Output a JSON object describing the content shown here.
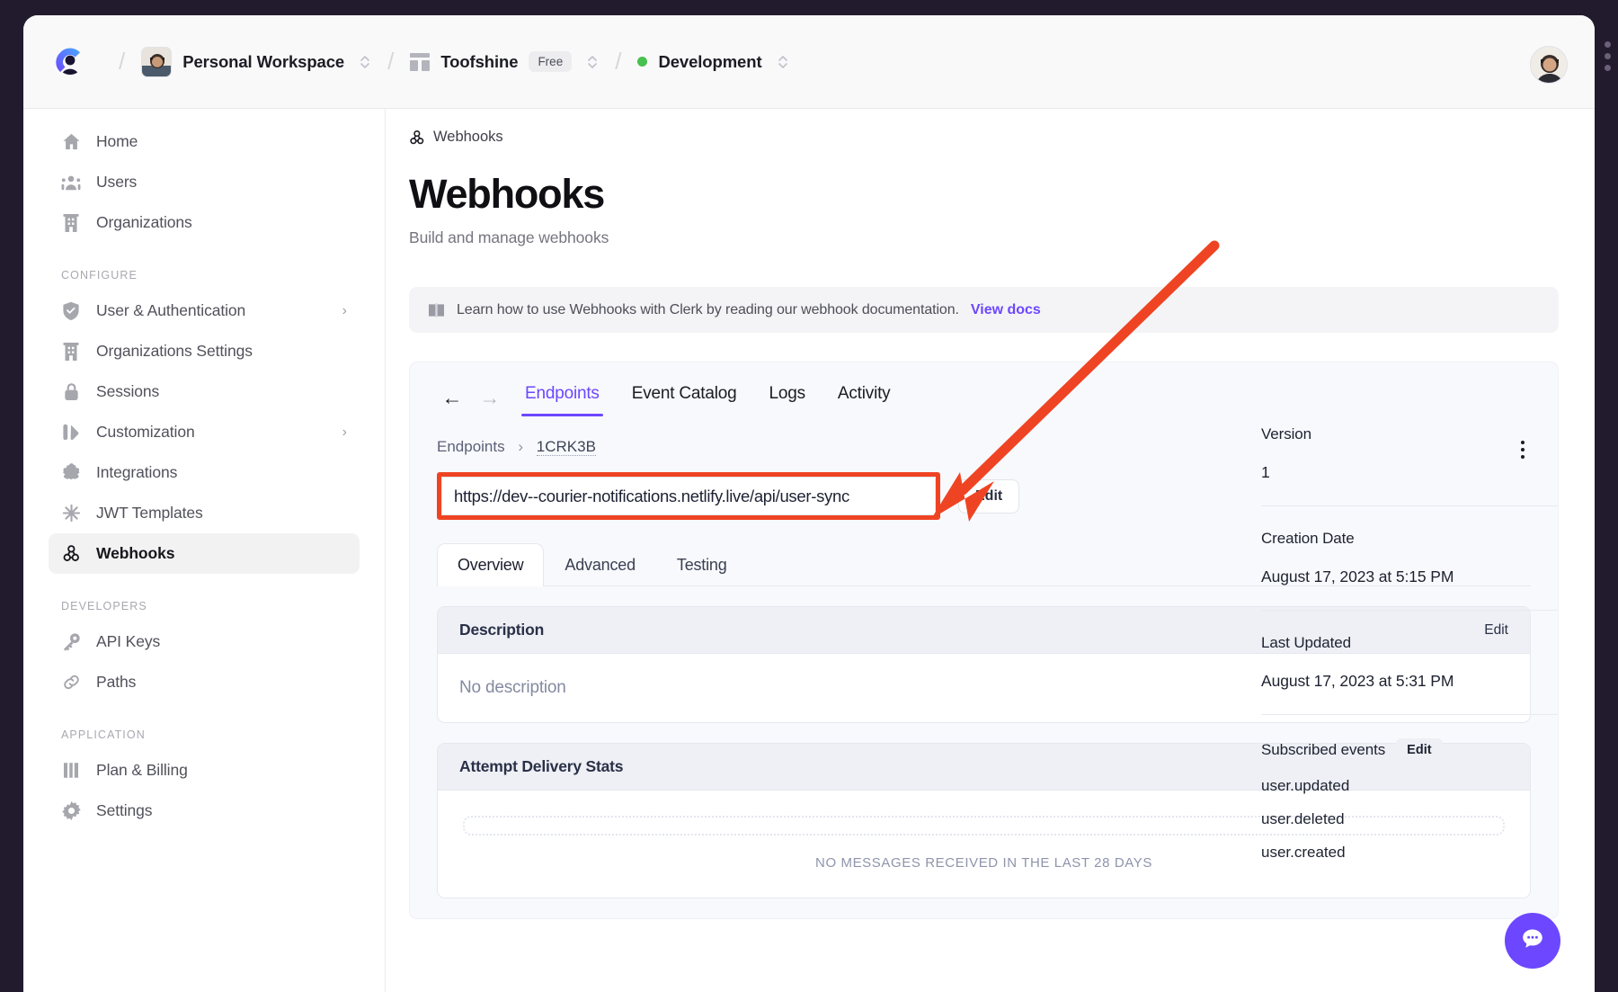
{
  "topbar": {
    "logo_icon": "clerk-logo-icon",
    "workspace": {
      "label": "Personal Workspace",
      "avatar_icon": "user-avatar-icon",
      "switcher_icon": "chevron-updown-icon"
    },
    "application": {
      "label": "Toofshine",
      "plan_badge": "Free",
      "app_icon": "app-grid-icon",
      "switcher_icon": "chevron-updown-icon"
    },
    "environment": {
      "label": "Development",
      "status_dot_color": "#46c14f",
      "switcher_icon": "chevron-updown-icon"
    },
    "separator": "/",
    "user_avatar_icon": "user-avatar-icon"
  },
  "sidebar": {
    "items": [
      {
        "label": "Home",
        "icon": "home-icon",
        "active": false,
        "chevron": false
      },
      {
        "label": "Users",
        "icon": "users-icon",
        "active": false,
        "chevron": false
      },
      {
        "label": "Organizations",
        "icon": "building-icon",
        "active": false,
        "chevron": false
      }
    ],
    "sections": [
      {
        "title": "CONFIGURE",
        "items": [
          {
            "label": "User & Authentication",
            "icon": "shield-check-icon",
            "active": false,
            "chevron": true
          },
          {
            "label": "Organizations Settings",
            "icon": "building-icon",
            "active": false,
            "chevron": false
          },
          {
            "label": "Sessions",
            "icon": "lock-icon",
            "active": false,
            "chevron": false
          },
          {
            "label": "Customization",
            "icon": "customization-icon",
            "active": false,
            "chevron": true
          },
          {
            "label": "Integrations",
            "icon": "puzzle-icon",
            "active": false,
            "chevron": false
          },
          {
            "label": "JWT Templates",
            "icon": "asterisk-icon",
            "active": false,
            "chevron": false
          },
          {
            "label": "Webhooks",
            "icon": "webhook-icon",
            "active": true,
            "chevron": false
          }
        ]
      },
      {
        "title": "DEVELOPERS",
        "items": [
          {
            "label": "API Keys",
            "icon": "key-icon",
            "active": false,
            "chevron": false
          },
          {
            "label": "Paths",
            "icon": "link-icon",
            "active": false,
            "chevron": false
          }
        ]
      },
      {
        "title": "APPLICATION",
        "items": [
          {
            "label": "Plan & Billing",
            "icon": "billing-icon",
            "active": false,
            "chevron": false
          },
          {
            "label": "Settings",
            "icon": "gear-icon",
            "active": false,
            "chevron": false
          }
        ]
      }
    ]
  },
  "main": {
    "breadcrumb": {
      "icon": "webhook-icon",
      "label": "Webhooks"
    },
    "title": "Webhooks",
    "subtitle": "Build and manage webhooks",
    "banner": {
      "icon": "book-icon",
      "text": "Learn how to use Webhooks with Clerk by reading our webhook documentation.",
      "link_label": "View docs",
      "link_color": "#6c47ff"
    }
  },
  "svix": {
    "nav_back_icon": "arrow-left-icon",
    "nav_forward_icon": "arrow-right-icon",
    "tabs": [
      {
        "label": "Endpoints",
        "active": true
      },
      {
        "label": "Event Catalog",
        "active": false
      },
      {
        "label": "Logs",
        "active": false
      },
      {
        "label": "Activity",
        "active": false
      }
    ],
    "accent_color": "#6c47ff",
    "breadcrumb": {
      "root": "Endpoints",
      "separator": "›",
      "current": "1CRK3B"
    },
    "kebab_icon": "more-vertical-icon",
    "endpoint_url": "https://dev--courier-notifications.netlify.live/api/user-sync",
    "url_highlight_color": "#ef4423",
    "edit_button": "Edit",
    "inner_tabs": [
      {
        "label": "Overview",
        "active": true
      },
      {
        "label": "Advanced",
        "active": false
      },
      {
        "label": "Testing",
        "active": false
      }
    ],
    "description_card": {
      "title": "Description",
      "edit_label": "Edit",
      "body": "No description"
    },
    "stats_card": {
      "title": "Attempt Delivery Stats",
      "empty_text": "NO MESSAGES RECEIVED IN THE LAST 28 DAYS"
    },
    "meta": {
      "version_label": "Version",
      "version_value": "1",
      "creation_label": "Creation Date",
      "creation_value": "August 17, 2023 at 5:15 PM",
      "updated_label": "Last Updated",
      "updated_value": "August 17, 2023 at 5:31 PM",
      "events_label": "Subscribed events",
      "events_edit": "Edit",
      "events": [
        "user.updated",
        "user.deleted",
        "user.created"
      ]
    }
  },
  "chat": {
    "icon": "chat-bubble-icon",
    "color": "#6c47ff"
  }
}
